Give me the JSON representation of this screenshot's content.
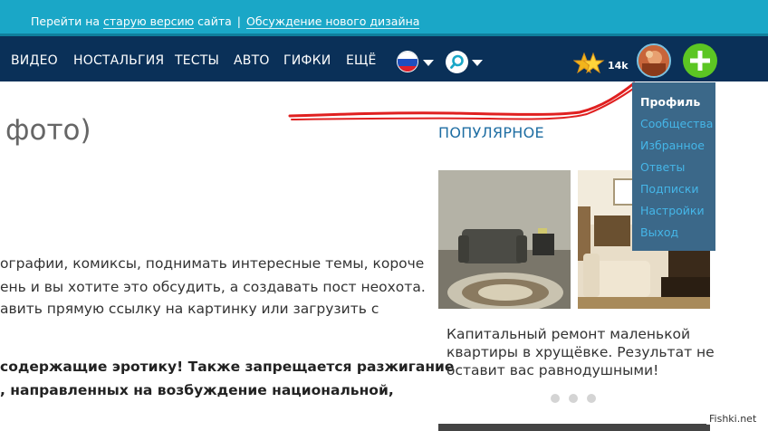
{
  "topbar": {
    "prefix": "Перейти на ",
    "old_link": "старую версию",
    "suffix": " сайта",
    "separator": "|",
    "discussion_link": "Обсуждение нового дизайна"
  },
  "nav": {
    "items": [
      "ВИДЕО",
      "НОСТАЛЬГИЯ",
      "ТЕСТЫ",
      "АВТО",
      "ГИФКИ",
      "ЕЩЁ"
    ],
    "karma": "14k"
  },
  "article": {
    "heading": "фото)",
    "paragraphs": [
      "ографии, комиксы, поднимать интересные темы, короче",
      "ень и вы хотите это обсудить, а создавать пост неохота.",
      "авить прямую ссылку на картинку или загрузить с"
    ],
    "rules": [
      " содержащие эротику! Также запрещается разжигание",
      ", направленных на возбуждение национальной,"
    ]
  },
  "popular": {
    "title": "ПОПУЛЯРНОЕ",
    "caption": [
      "Капитальный ремонт маленькой",
      "квартиры в хрущёвке. Результат не",
      "оставит вас равнодушными!"
    ]
  },
  "dropdown": {
    "items": [
      "Профиль",
      "Сообщества",
      "Избранное",
      "Ответы",
      "Подписки",
      "Настройки",
      "Выход"
    ]
  },
  "watermark": "Fishki.net",
  "colors": {
    "topbar": "#1aa7c7",
    "navbar": "#0a3058",
    "dropdown": "#3b6889",
    "link": "#45b6e8",
    "plus": "#5cc623",
    "popular_title": "#1f6ea3",
    "scribble": "#e02020"
  }
}
